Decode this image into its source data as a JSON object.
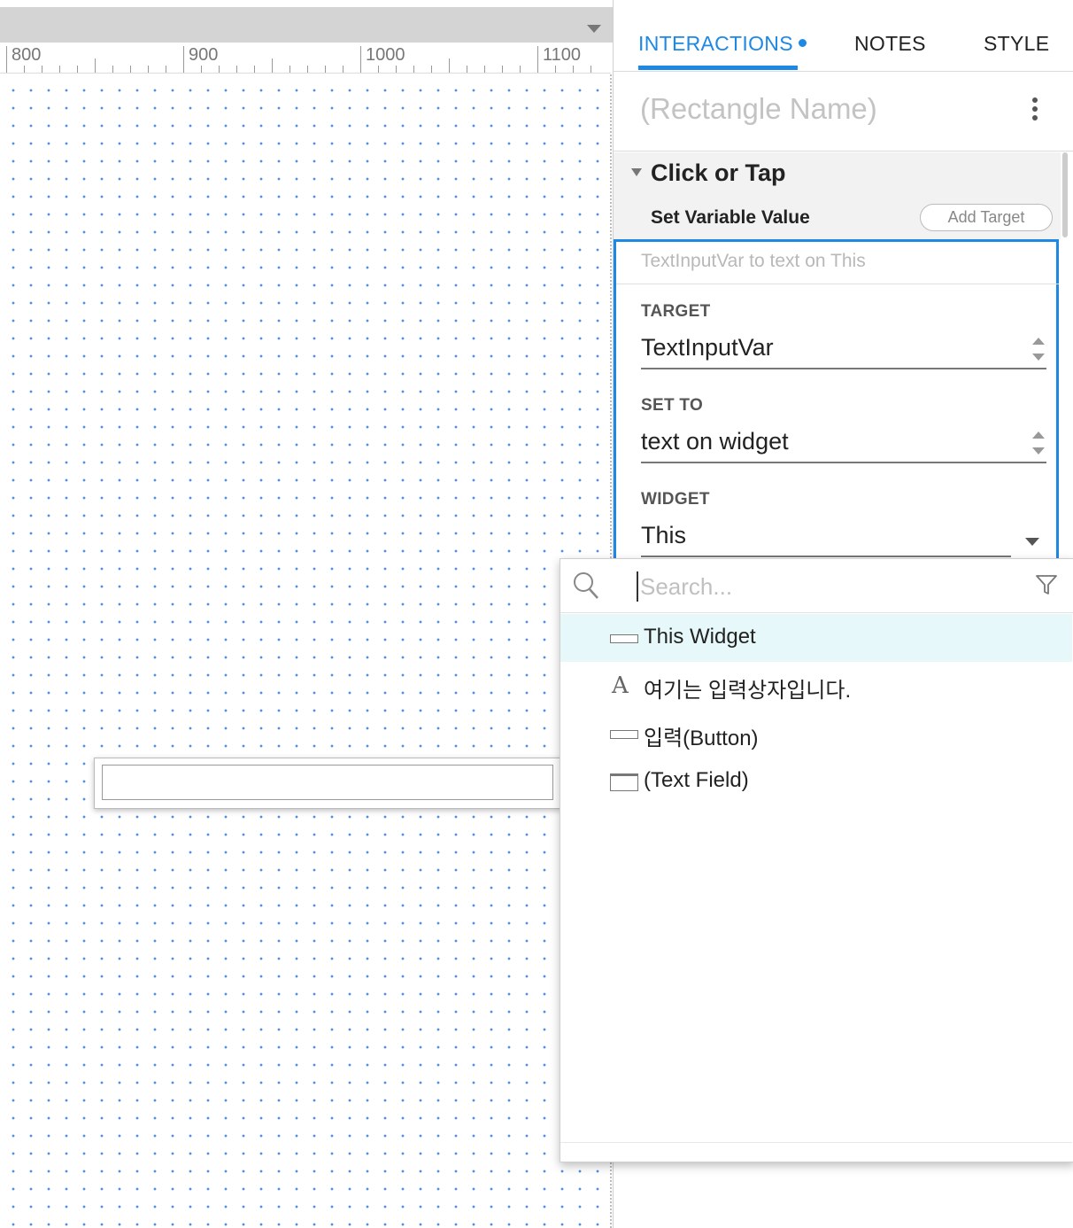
{
  "ruler": {
    "labels": [
      "800",
      "900",
      "1000",
      "1100"
    ]
  },
  "tabs": {
    "interactions": "INTERACTIONS",
    "notes": "NOTES",
    "style": "STYLE"
  },
  "widget_name": {
    "placeholder": "(Rectangle Name)"
  },
  "event": {
    "title": "Click or Tap"
  },
  "action": {
    "title": "Set Variable Value",
    "add_target_label": "Add Target",
    "summary": "TextInputVar to text on This",
    "target_label": "TARGET",
    "target_value": "TextInputVar",
    "set_to_label": "SET TO",
    "set_to_value": "text on widget",
    "widget_label": "WIDGET",
    "widget_value": "This"
  },
  "dropdown": {
    "search_placeholder": "Search...",
    "items": [
      {
        "icon": "button-shape-icon",
        "label": "This Widget",
        "selected": true
      },
      {
        "icon": "text-label-icon",
        "label": "여기는 입력상자입니다.",
        "selected": false
      },
      {
        "icon": "button-shape-icon",
        "label": "입력(Button)",
        "selected": false
      },
      {
        "icon": "text-field-icon",
        "label": "(Text Field)",
        "selected": false
      }
    ]
  },
  "colors": {
    "accent": "#1e88e5",
    "selected_row": "#e6f8f9",
    "grid_dot": "#4d8fe6"
  }
}
